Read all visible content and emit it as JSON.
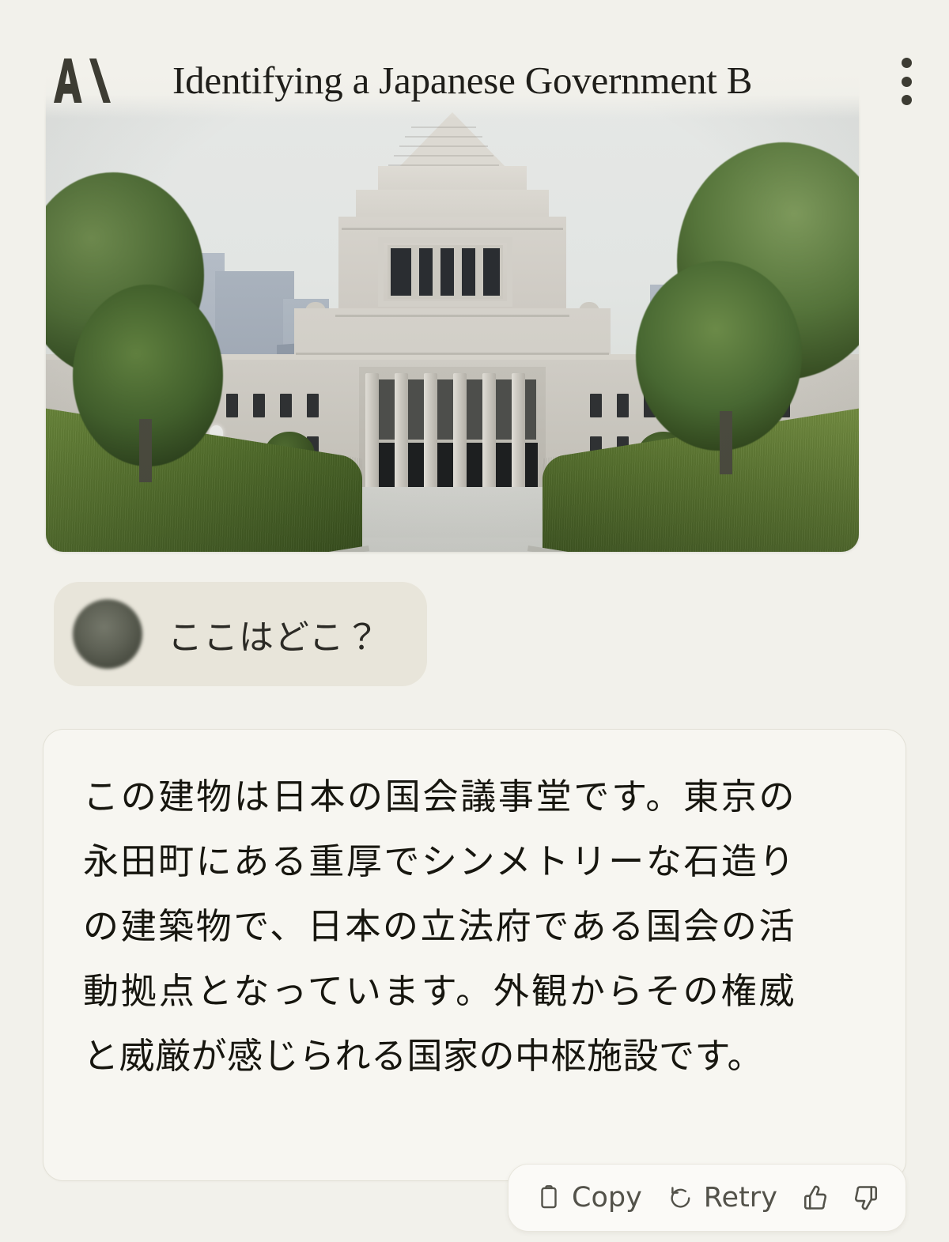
{
  "app": {
    "brand_logo": "anthropic-logo",
    "background_color": "#f2f1eb"
  },
  "header": {
    "title": "Identifying a Japanese Government B",
    "title_full_hint_truncated": true,
    "menu_icon": "kebab-menu-icon"
  },
  "attachment": {
    "type": "photo",
    "alt": "National Diet Building of Japan, stone symmetrical government building with central stepped tower, trees and trimmed hedges flanking a central walkway",
    "corner_radius_px": 22
  },
  "messages": [
    {
      "role": "user",
      "avatar": "user-avatar",
      "text": "ここはどこ？"
    },
    {
      "role": "assistant",
      "text": "この建物は日本の国会議事堂です。東京の永田町にある重厚でシンメトリーな石造りの建築物で、日本の立法府である国会の活動拠点となっています。外観からその権威と威厳が感じられる国家の中枢施設です。"
    }
  ],
  "actions": {
    "copy": {
      "label": "Copy",
      "icon": "clipboard-icon"
    },
    "retry": {
      "label": "Retry",
      "icon": "refresh-ccw-icon"
    },
    "thumbs_up": {
      "label": "",
      "icon": "thumbs-up-icon"
    },
    "thumbs_down": {
      "label": "",
      "icon": "thumbs-down-icon"
    }
  },
  "colors": {
    "page_background": "#f2f1eb",
    "user_bubble": "#e8e5da",
    "assistant_bubble": "#f7f6f1",
    "assistant_border": "#e3e1d7",
    "logo": "#3d3c33",
    "text_primary": "#17160f",
    "action_text": "#53524a",
    "avatar": "#5e6155"
  }
}
